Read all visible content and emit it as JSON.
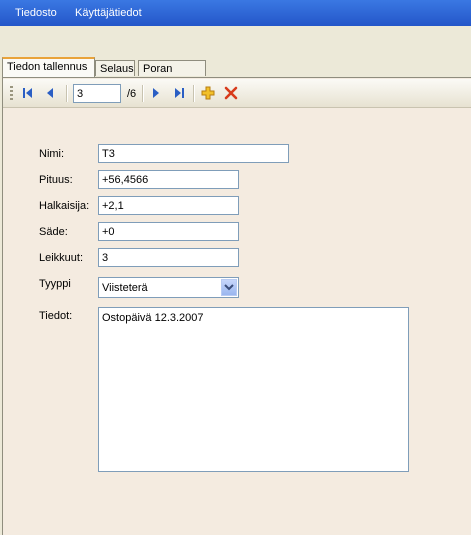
{
  "menubar": {
    "items": [
      "Tiedosto",
      "Käyttäjätiedot"
    ]
  },
  "tabs": [
    {
      "label": "Tiedon tallennus",
      "active": true
    },
    {
      "label": "Selaus",
      "active": false
    },
    {
      "label": "Poran tyyppi",
      "active": false
    }
  ],
  "navigator": {
    "position": "3",
    "total": "/6",
    "icons": [
      "first-record-icon",
      "previous-record-icon",
      "next-record-icon",
      "last-record-icon",
      "add-record-icon",
      "delete-record-icon"
    ]
  },
  "form": {
    "nimi_label": "Nimi:",
    "nimi_value": "T3",
    "pituus_label": "Pituus:",
    "pituus_value": "+56,4566",
    "halkaisija_label": "Halkaisija:",
    "halkaisija_value": "+2,1",
    "sade_label": "Säde:",
    "sade_value": "+0",
    "leikkuut_label": "Leikkuut:",
    "leikkuut_value": "3",
    "tyyppi_label": "Tyyppi",
    "tyyppi_value": "Viisteterä",
    "tiedot_label": "Tiedot:",
    "tiedot_value": "Ostopäivä 12.3.2007"
  },
  "colors": {
    "menubar": "#2f66d6",
    "panel": "#f4ebe0",
    "active_tab_accent": "#e9a33a",
    "delete_red": "#d83b1c",
    "add_yellow": "#f2c02a",
    "nav_blue": "#2a5ec4"
  }
}
